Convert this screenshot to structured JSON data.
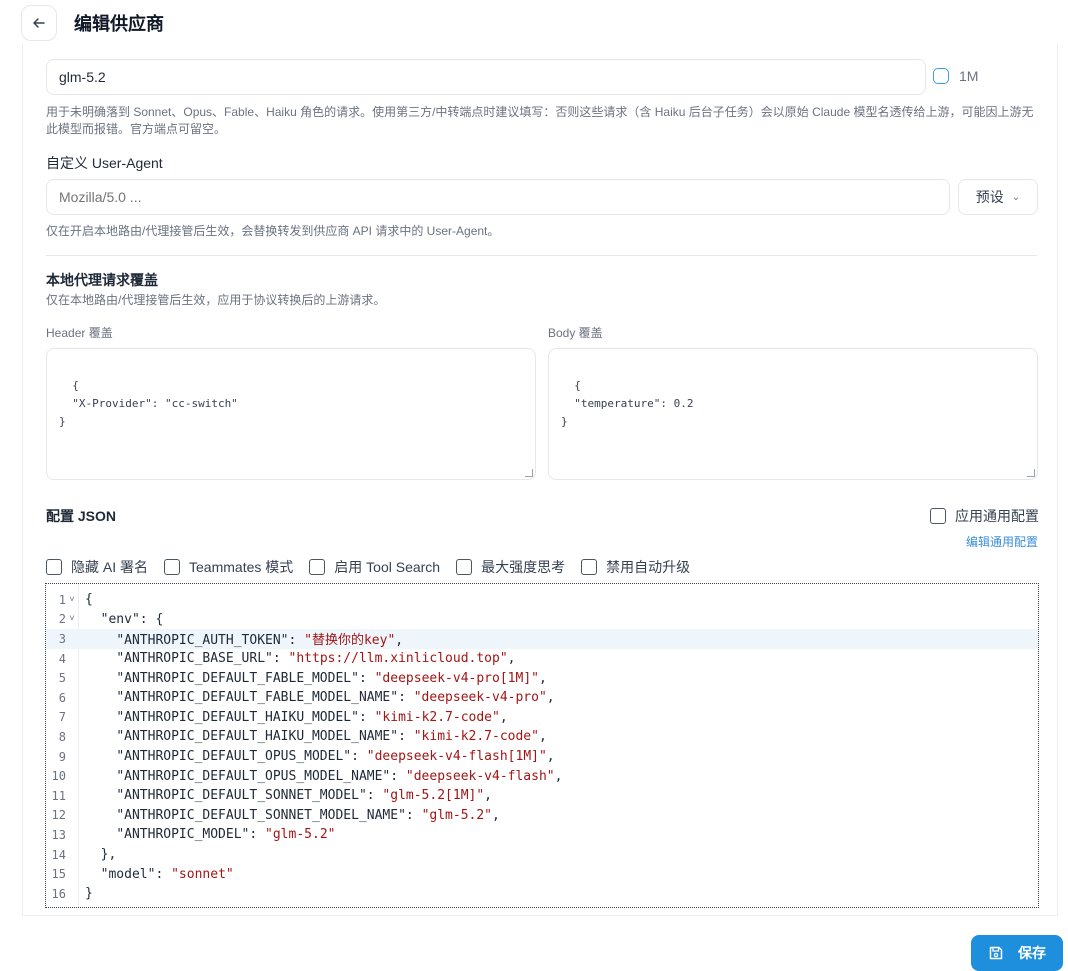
{
  "header": {
    "title": "编辑供应商"
  },
  "model_field": {
    "value": "glm-5.2",
    "option_1m_label": "1M",
    "help": "用于未明确落到 Sonnet、Opus、Fable、Haiku 角色的请求。使用第三方/中转端点时建议填写：否则这些请求（含 Haiku 后台子任务）会以原始 Claude 模型名透传给上游，可能因上游无",
    "help_line2": "此模型而报错。官方端点可留空。"
  },
  "user_agent": {
    "label": "自定义 User-Agent",
    "placeholder": "Mozilla/5.0 ...",
    "preset_label": "预设",
    "help": "仅在开启本地路由/代理接管后生效，会替换转发到供应商 API 请求中的 User-Agent。"
  },
  "proxy_override": {
    "title": "本地代理请求覆盖",
    "help": "仅在本地路由/代理接管后生效，应用于协议转换后的上游请求。",
    "header_label": "Header 覆盖",
    "header_value": "{\n  \"X-Provider\": \"cc-switch\"\n}",
    "body_label": "Body 覆盖",
    "body_value": "{\n  \"temperature\": 0.2\n}"
  },
  "config_json": {
    "title": "配置 JSON",
    "apply_common_label": "应用通用配置",
    "edit_common_link": "编辑通用配置",
    "options": [
      {
        "label": "隐藏 AI 署名"
      },
      {
        "label": "Teammates 模式"
      },
      {
        "label": "启用 Tool Search"
      },
      {
        "label": "最大强度思考"
      },
      {
        "label": "禁用自动升级"
      }
    ],
    "lines": [
      {
        "n": "1",
        "fold": "v",
        "indent": "",
        "key": "",
        "val": "",
        "tail": "{"
      },
      {
        "n": "2",
        "fold": "v",
        "indent": "  ",
        "key": "\"env\"",
        "val": "",
        "tail": ": {"
      },
      {
        "n": "3",
        "fold": "",
        "indent": "    ",
        "key": "\"ANTHROPIC_AUTH_TOKEN\"",
        "val": "\"替换你的key\"",
        "tail": ","
      },
      {
        "n": "4",
        "fold": "",
        "indent": "    ",
        "key": "\"ANTHROPIC_BASE_URL\"",
        "val": "\"https://llm.xinlicloud.top\"",
        "tail": ","
      },
      {
        "n": "5",
        "fold": "",
        "indent": "    ",
        "key": "\"ANTHROPIC_DEFAULT_FABLE_MODEL\"",
        "val": "\"deepseek-v4-pro[1M]\"",
        "tail": ","
      },
      {
        "n": "6",
        "fold": "",
        "indent": "    ",
        "key": "\"ANTHROPIC_DEFAULT_FABLE_MODEL_NAME\"",
        "val": "\"deepseek-v4-pro\"",
        "tail": ","
      },
      {
        "n": "7",
        "fold": "",
        "indent": "    ",
        "key": "\"ANTHROPIC_DEFAULT_HAIKU_MODEL\"",
        "val": "\"kimi-k2.7-code\"",
        "tail": ","
      },
      {
        "n": "8",
        "fold": "",
        "indent": "    ",
        "key": "\"ANTHROPIC_DEFAULT_HAIKU_MODEL_NAME\"",
        "val": "\"kimi-k2.7-code\"",
        "tail": ","
      },
      {
        "n": "9",
        "fold": "",
        "indent": "    ",
        "key": "\"ANTHROPIC_DEFAULT_OPUS_MODEL\"",
        "val": "\"deepseek-v4-flash[1M]\"",
        "tail": ","
      },
      {
        "n": "10",
        "fold": "",
        "indent": "    ",
        "key": "\"ANTHROPIC_DEFAULT_OPUS_MODEL_NAME\"",
        "val": "\"deepseek-v4-flash\"",
        "tail": ","
      },
      {
        "n": "11",
        "fold": "",
        "indent": "    ",
        "key": "\"ANTHROPIC_DEFAULT_SONNET_MODEL\"",
        "val": "\"glm-5.2[1M]\"",
        "tail": ","
      },
      {
        "n": "12",
        "fold": "",
        "indent": "    ",
        "key": "\"ANTHROPIC_DEFAULT_SONNET_MODEL_NAME\"",
        "val": "\"glm-5.2\"",
        "tail": ","
      },
      {
        "n": "13",
        "fold": "",
        "indent": "    ",
        "key": "\"ANTHROPIC_MODEL\"",
        "val": "\"glm-5.2\"",
        "tail": ""
      },
      {
        "n": "14",
        "fold": "",
        "indent": "  ",
        "key": "",
        "val": "",
        "tail": "},"
      },
      {
        "n": "15",
        "fold": "",
        "indent": "  ",
        "key": "\"model\"",
        "val": "\"sonnet\"",
        "tail": ""
      },
      {
        "n": "16",
        "fold": "",
        "indent": "",
        "key": "",
        "val": "",
        "tail": "}"
      }
    ],
    "active_line": 3
  },
  "footer": {
    "save_label": "保存"
  },
  "colors": {
    "accent": "#1e8fdc",
    "string": "#a31515",
    "active_line_bg": "#eef6fc"
  }
}
